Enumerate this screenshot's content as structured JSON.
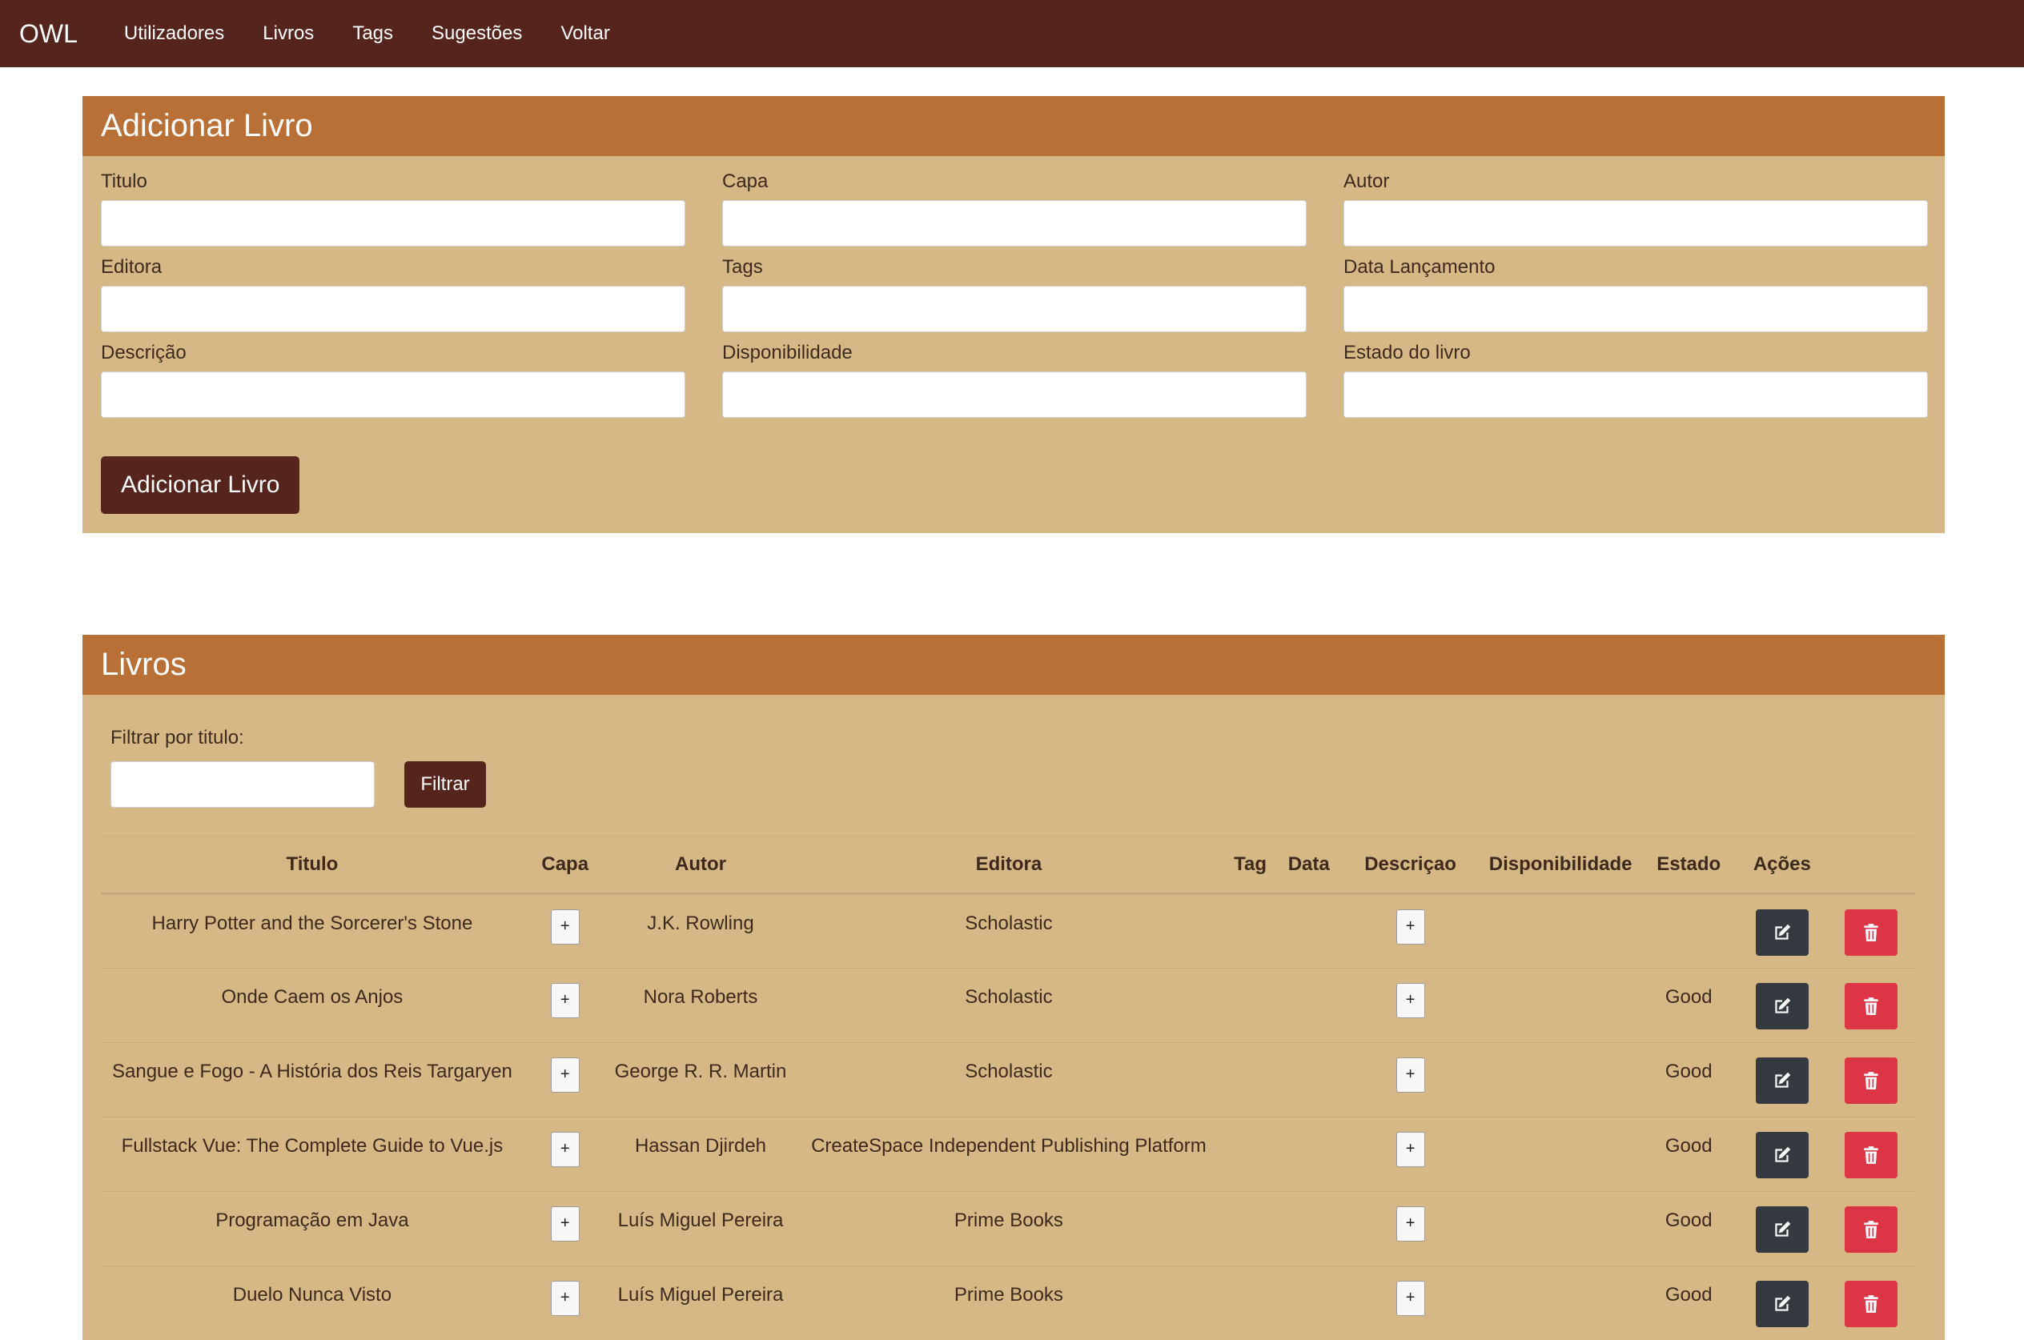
{
  "navbar": {
    "brand": "OWL",
    "items": [
      "Utilizadores",
      "Livros",
      "Tags",
      "Sugestões",
      "Voltar"
    ]
  },
  "add_form": {
    "title": "Adicionar Livro",
    "fields": [
      {
        "label": "Titulo",
        "value": ""
      },
      {
        "label": "Capa",
        "value": ""
      },
      {
        "label": "Autor",
        "value": ""
      },
      {
        "label": "Editora",
        "value": ""
      },
      {
        "label": "Tags",
        "value": ""
      },
      {
        "label": "Data Lançamento",
        "value": ""
      },
      {
        "label": "Descrição",
        "value": ""
      },
      {
        "label": "Disponibilidade",
        "value": ""
      },
      {
        "label": "Estado do livro",
        "value": ""
      }
    ],
    "submit_label": "Adicionar Livro"
  },
  "books": {
    "title": "Livros",
    "filter_label": "Filtrar por titulo:",
    "filter_value": "",
    "filter_button": "Filtrar",
    "columns": [
      "Titulo",
      "Capa",
      "Autor",
      "Editora",
      "Tag",
      "Data",
      "Descriçao",
      "Disponibilidade",
      "Estado",
      "Ações"
    ],
    "cover_button": "+",
    "description_button": "+",
    "rows": [
      {
        "titulo": "Harry Potter and the Sorcerer's Stone",
        "autor": "J.K. Rowling",
        "editora": "Scholastic",
        "tag": "",
        "data": "",
        "disponibilidade": "",
        "estado": ""
      },
      {
        "titulo": "Onde Caem os Anjos",
        "autor": "Nora Roberts",
        "editora": "Scholastic",
        "tag": "",
        "data": "",
        "disponibilidade": "",
        "estado": "Good"
      },
      {
        "titulo": "Sangue e Fogo - A História dos Reis Targaryen",
        "autor": "George R. R. Martin",
        "editora": "Scholastic",
        "tag": "",
        "data": "",
        "disponibilidade": "",
        "estado": "Good"
      },
      {
        "titulo": "Fullstack Vue: The Complete Guide to Vue.js",
        "autor": "Hassan Djirdeh",
        "editora": "CreateSpace Independent Publishing Platform",
        "tag": "",
        "data": "",
        "disponibilidade": "",
        "estado": "Good"
      },
      {
        "titulo": "Programação em Java",
        "autor": "Luís Miguel Pereira",
        "editora": "Prime Books",
        "tag": "",
        "data": "",
        "disponibilidade": "",
        "estado": "Good"
      },
      {
        "titulo": "Duelo Nunca Visto",
        "autor": "Luís Miguel Pereira",
        "editora": "Prime Books",
        "tag": "",
        "data": "",
        "disponibilidade": "",
        "estado": "Good"
      }
    ]
  },
  "icons": {
    "edit": "edit-icon",
    "delete": "trash-icon"
  },
  "colors": {
    "navbar": "#54241d",
    "card_header": "#b87036",
    "card_body": "#d6b887",
    "primary_button": "#54241d",
    "edit_button": "#343a40",
    "delete_button": "#dc3545"
  }
}
